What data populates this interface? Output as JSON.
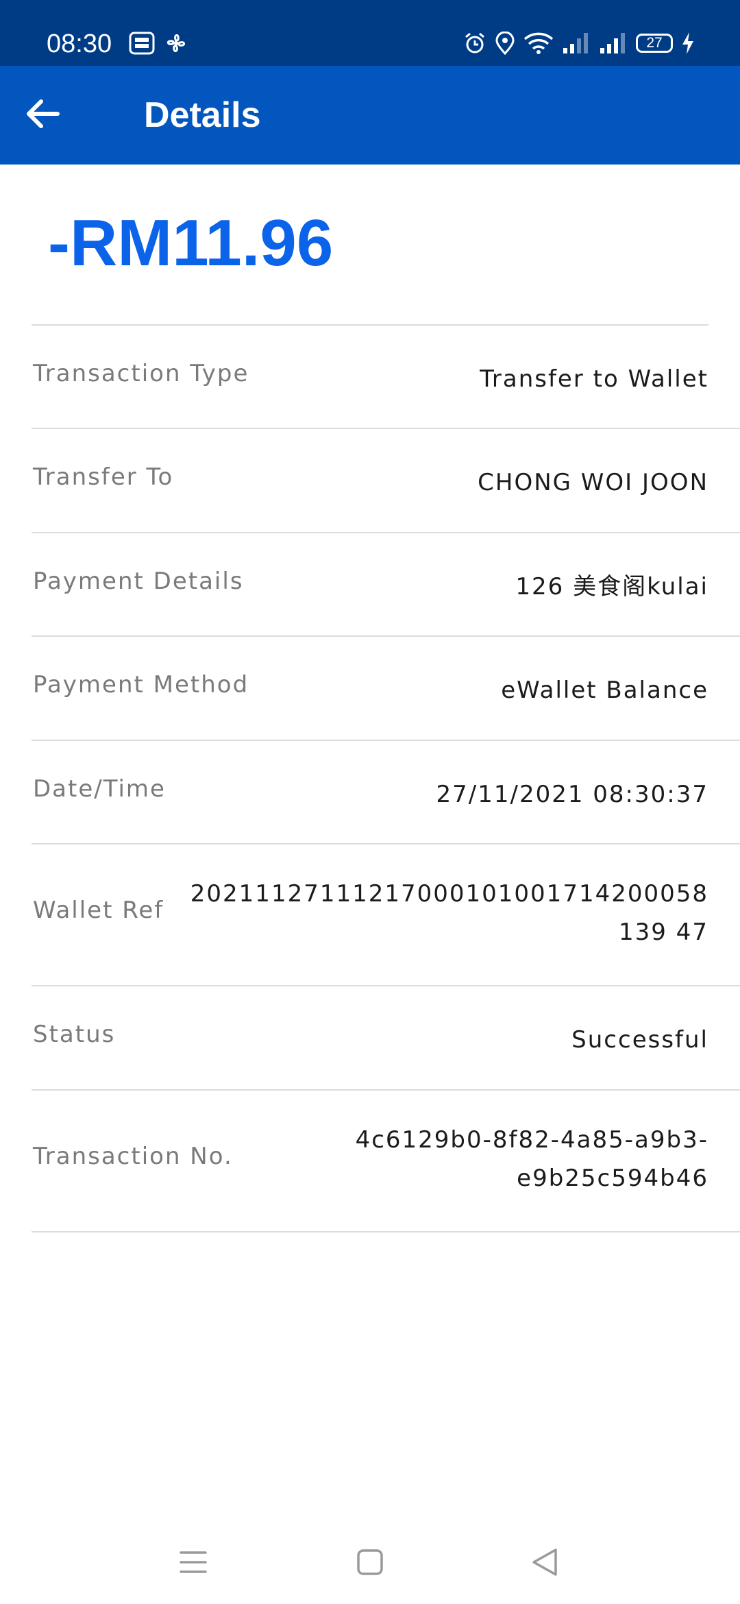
{
  "status_bar": {
    "time": "08:30",
    "battery_level": "27",
    "icons": [
      "touch-n-go-ewallet-icon",
      "fan-icon",
      "alarm-icon",
      "location-icon",
      "wifi-icon",
      "signal-icon",
      "signal-icon",
      "battery-icon",
      "charging-icon"
    ]
  },
  "app_bar": {
    "title": "Details",
    "back_icon": "arrow-left-icon"
  },
  "amount": "-RM11.96",
  "details": [
    {
      "label": "Transaction Type",
      "value": "Transfer to Wallet"
    },
    {
      "label": "Transfer To",
      "value": "CHONG WOI JOON"
    },
    {
      "label": "Payment Details",
      "value": "126 美食阁kulai"
    },
    {
      "label": "Payment Method",
      "value": "eWallet Balance"
    },
    {
      "label": "Date/Time",
      "value": "27/11/2021 08:30:37"
    },
    {
      "label": "Wallet Ref",
      "value": "20211127111217000101001714200058139 47"
    },
    {
      "label": "Status",
      "value": "Successful"
    },
    {
      "label": "Transaction No.",
      "value": "4c6129b0-8f82-4a85-a9b3- e9b25c594b46"
    }
  ],
  "colors": {
    "status_bar": "#003c86",
    "app_bar": "#0356be",
    "amount": "#0a63e8",
    "divider": "#dcdcdc",
    "label": "#7a7a7a"
  },
  "nav_bar": {
    "icons": [
      "menu-icon",
      "home-square-icon",
      "back-triangle-icon"
    ]
  }
}
